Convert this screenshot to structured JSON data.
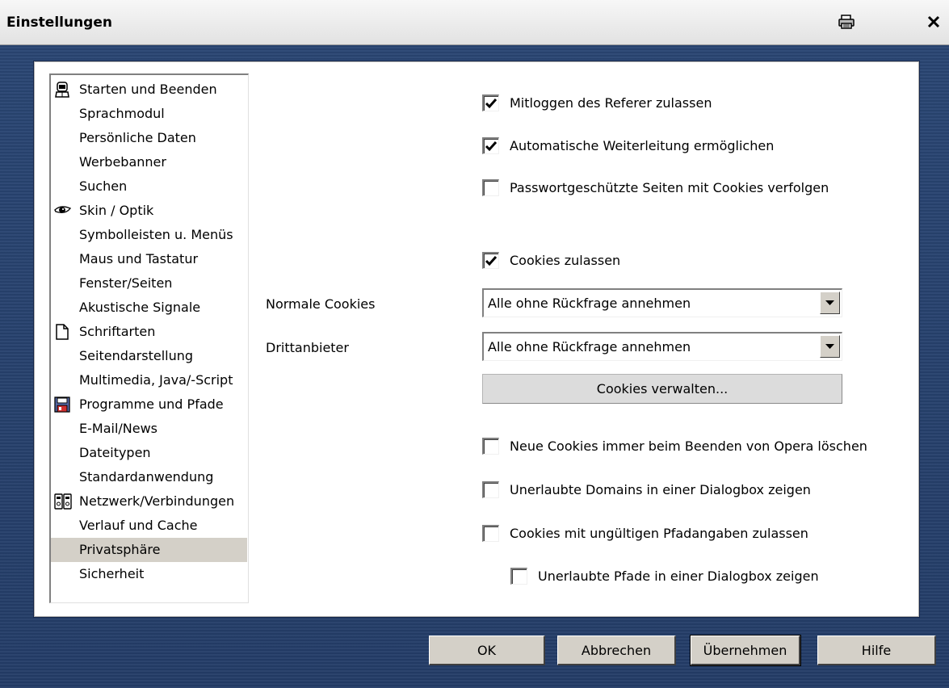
{
  "window": {
    "title": "Einstellungen"
  },
  "nav": {
    "items": [
      {
        "label": "Starten und Beenden",
        "icon": "person-icon"
      },
      {
        "label": "Sprachmodul"
      },
      {
        "label": "Persönliche Daten"
      },
      {
        "label": "Werbebanner"
      },
      {
        "label": "Suchen"
      },
      {
        "label": "Skin / Optik",
        "icon": "eye-icon"
      },
      {
        "label": "Symbolleisten u. Menüs"
      },
      {
        "label": "Maus und Tastatur"
      },
      {
        "label": "Fenster/Seiten"
      },
      {
        "label": "Akustische Signale"
      },
      {
        "label": "Schriftarten",
        "icon": "document-icon"
      },
      {
        "label": "Seitendarstellung"
      },
      {
        "label": "Multimedia, Java/-Script"
      },
      {
        "label": "Programme und Pfade",
        "icon": "floppy-icon"
      },
      {
        "label": "E-Mail/News"
      },
      {
        "label": "Dateitypen"
      },
      {
        "label": "Standardanwendung"
      },
      {
        "label": "Netzwerk/Verbindungen",
        "icon": "network-icon"
      },
      {
        "label": "Verlauf und Cache"
      },
      {
        "label": "Privatsphäre",
        "selected": true
      },
      {
        "label": "Sicherheit"
      }
    ]
  },
  "privacy": {
    "referer_label": "Mitloggen des Referer zulassen",
    "referer_checked": true,
    "redirect_label": "Automatische Weiterleitung ermöglichen",
    "redirect_checked": true,
    "password_cookies_label": "Passwortgeschützte Seiten mit Cookies verfolgen",
    "password_cookies_checked": false,
    "cookies_label": "Cookies zulassen",
    "cookies_checked": true,
    "normal_cookies_label": "Normale Cookies",
    "normal_cookies_value": "Alle ohne Rückfrage annehmen",
    "third_party_label": "Drittanbieter",
    "third_party_value": "Alle ohne Rückfrage annehmen",
    "manage_cookies_button": "Cookies verwalten...",
    "delete_on_exit_label": "Neue Cookies immer beim Beenden von Opera löschen",
    "delete_on_exit_checked": false,
    "unauthorized_domains_label": "Unerlaubte Domains in einer Dialogbox zeigen",
    "unauthorized_domains_checked": false,
    "invalid_paths_label": "Cookies mit ungültigen Pfadangaben zulassen",
    "invalid_paths_checked": false,
    "unauthorized_paths_label": "Unerlaubte Pfade in einer Dialogbox zeigen",
    "unauthorized_paths_checked": false
  },
  "footer": {
    "ok": "OK",
    "cancel": "Abbrechen",
    "apply": "Übernehmen",
    "help": "Hilfe"
  }
}
